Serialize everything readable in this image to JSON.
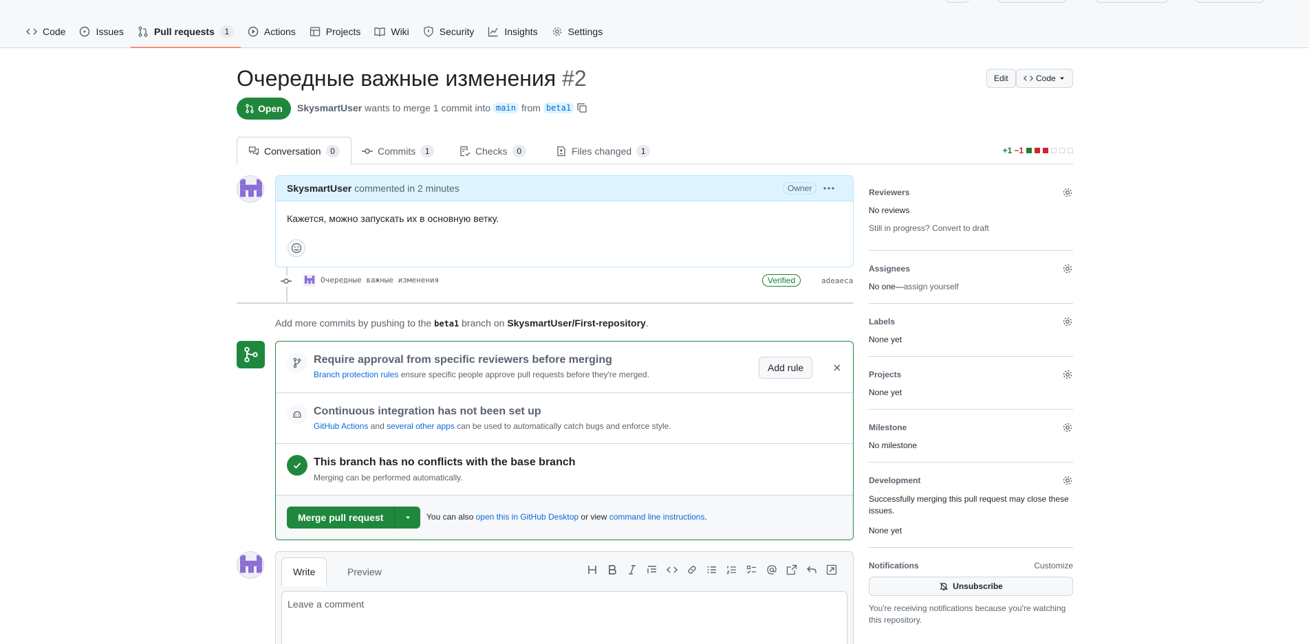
{
  "nav": {
    "items": [
      {
        "label": "Code",
        "icon": "code-icon"
      },
      {
        "label": "Issues",
        "icon": "issue-icon"
      },
      {
        "label": "Pull requests",
        "icon": "pull-request-icon",
        "count": "1"
      },
      {
        "label": "Actions",
        "icon": "play-icon"
      },
      {
        "label": "Projects",
        "icon": "table-icon"
      },
      {
        "label": "Wiki",
        "icon": "book-icon"
      },
      {
        "label": "Security",
        "icon": "shield-icon"
      },
      {
        "label": "Insights",
        "icon": "graph-icon"
      },
      {
        "label": "Settings",
        "icon": "gear-icon"
      }
    ]
  },
  "pr": {
    "title": "Очередные важные изменения",
    "number": "#2",
    "state": "Open",
    "author": "SkysmartUser",
    "meta_text": "wants to merge 1 commit into",
    "base_branch": "main",
    "from_text": "from",
    "head_branch": "beta1",
    "edit_label": "Edit",
    "code_label": "Code"
  },
  "tabs": [
    {
      "label": "Conversation",
      "count": "0",
      "icon": "comment-discussion-icon"
    },
    {
      "label": "Commits",
      "count": "1",
      "icon": "commit-icon"
    },
    {
      "label": "Checks",
      "count": "0",
      "icon": "checklist-icon"
    },
    {
      "label": "Files changed",
      "count": "1",
      "icon": "file-diff-icon"
    }
  ],
  "diffstat": {
    "additions": "+1",
    "deletions": "−1",
    "colors": [
      "#1a7f37",
      "#1a7f37",
      "#cf222e",
      "#cf222e"
    ]
  },
  "comment": {
    "author": "SkysmartUser",
    "action": "commented",
    "time": "in 2 minutes",
    "badge": "Owner",
    "body": "Кажется, можно запускать их в основную ветку."
  },
  "commit": {
    "message": "Очередные важные изменения",
    "verified": "Verified",
    "sha": "adeaeca"
  },
  "push_hint": {
    "prefix": "Add more commits by pushing to the",
    "branch": "beta1",
    "mid": "branch on",
    "repo": "SkysmartUser/First-repository",
    "suffix": "."
  },
  "merge_box": {
    "rule_title": "Require approval from specific reviewers before merging",
    "rule_link": "Branch protection rules",
    "rule_sub": "ensure specific people approve pull requests before they're merged.",
    "add_rule": "Add rule",
    "ci_title": "Continuous integration has not been set up",
    "ci_link1": "GitHub Actions",
    "ci_and": "and",
    "ci_link2": "several other apps",
    "ci_sub": "can be used to automatically catch bugs and enforce style.",
    "conflict_title": "This branch has no conflicts with the base branch",
    "conflict_sub": "Merging can be performed automatically.",
    "merge_label": "Merge pull request",
    "note_prefix": "You can also",
    "note_link1": "open this in GitHub Desktop",
    "note_mid": "or view",
    "note_link2": "command line instructions",
    "note_suffix": "."
  },
  "new_comment": {
    "write_tab": "Write",
    "preview_tab": "Preview",
    "placeholder": "Leave a comment"
  },
  "sidebar": {
    "reviewers": {
      "title": "Reviewers",
      "value": "No reviews",
      "progress": "Still in progress?",
      "draft_link": "Convert to draft"
    },
    "assignees": {
      "title": "Assignees",
      "value": "No one—",
      "assign_link": "assign yourself"
    },
    "labels": {
      "title": "Labels",
      "value": "None yet"
    },
    "projects": {
      "title": "Projects",
      "value": "None yet"
    },
    "milestone": {
      "title": "Milestone",
      "value": "No milestone"
    },
    "development": {
      "title": "Development",
      "desc": "Successfully merging this pull request may close these issues.",
      "value": "None yet"
    },
    "notifications": {
      "title": "Notifications",
      "customize": "Customize",
      "unsubscribe": "Unsubscribe",
      "reason": "You're receiving notifications because you're watching this repository."
    }
  }
}
